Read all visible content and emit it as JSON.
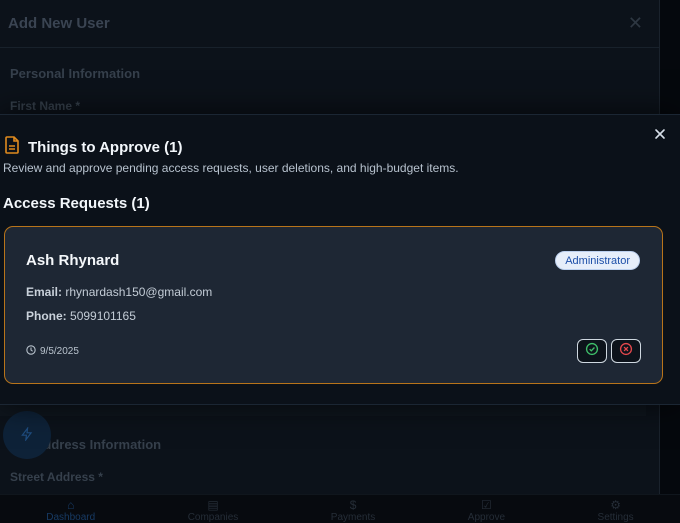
{
  "background": {
    "dialog_title": "Add New User",
    "section_personal": "Personal Information",
    "label_first_name": "First Name *",
    "phone_value_partial": "5099101165",
    "section_address": "Address Information",
    "label_street": "Street Address *"
  },
  "bottom_nav": {
    "items": [
      {
        "label": "Dashboard",
        "icon": "home-icon"
      },
      {
        "label": "Companies",
        "icon": "building-icon"
      },
      {
        "label": "Payments",
        "icon": "dollar-icon"
      },
      {
        "label": "Approve",
        "icon": "check-square-icon"
      },
      {
        "label": "Settings",
        "icon": "gear-icon"
      }
    ]
  },
  "panel": {
    "title": "Things to Approve (1)",
    "description": "Review and approve pending access requests, user deletions, and high-budget items.",
    "section_title": "Access Requests (1)",
    "close_label": "×"
  },
  "request": {
    "name": "Ash Rhynard",
    "role": "Administrator",
    "email_label": "Email:",
    "email": "rhynardash150@gmail.com",
    "phone_label": "Phone:",
    "phone": "5099101165",
    "date": "9/5/2025"
  },
  "colors": {
    "accent_orange": "#b8741a",
    "approve_green": "#3fbf6a",
    "reject_red": "#e5484d",
    "badge_blue": "#1d4fa8"
  }
}
